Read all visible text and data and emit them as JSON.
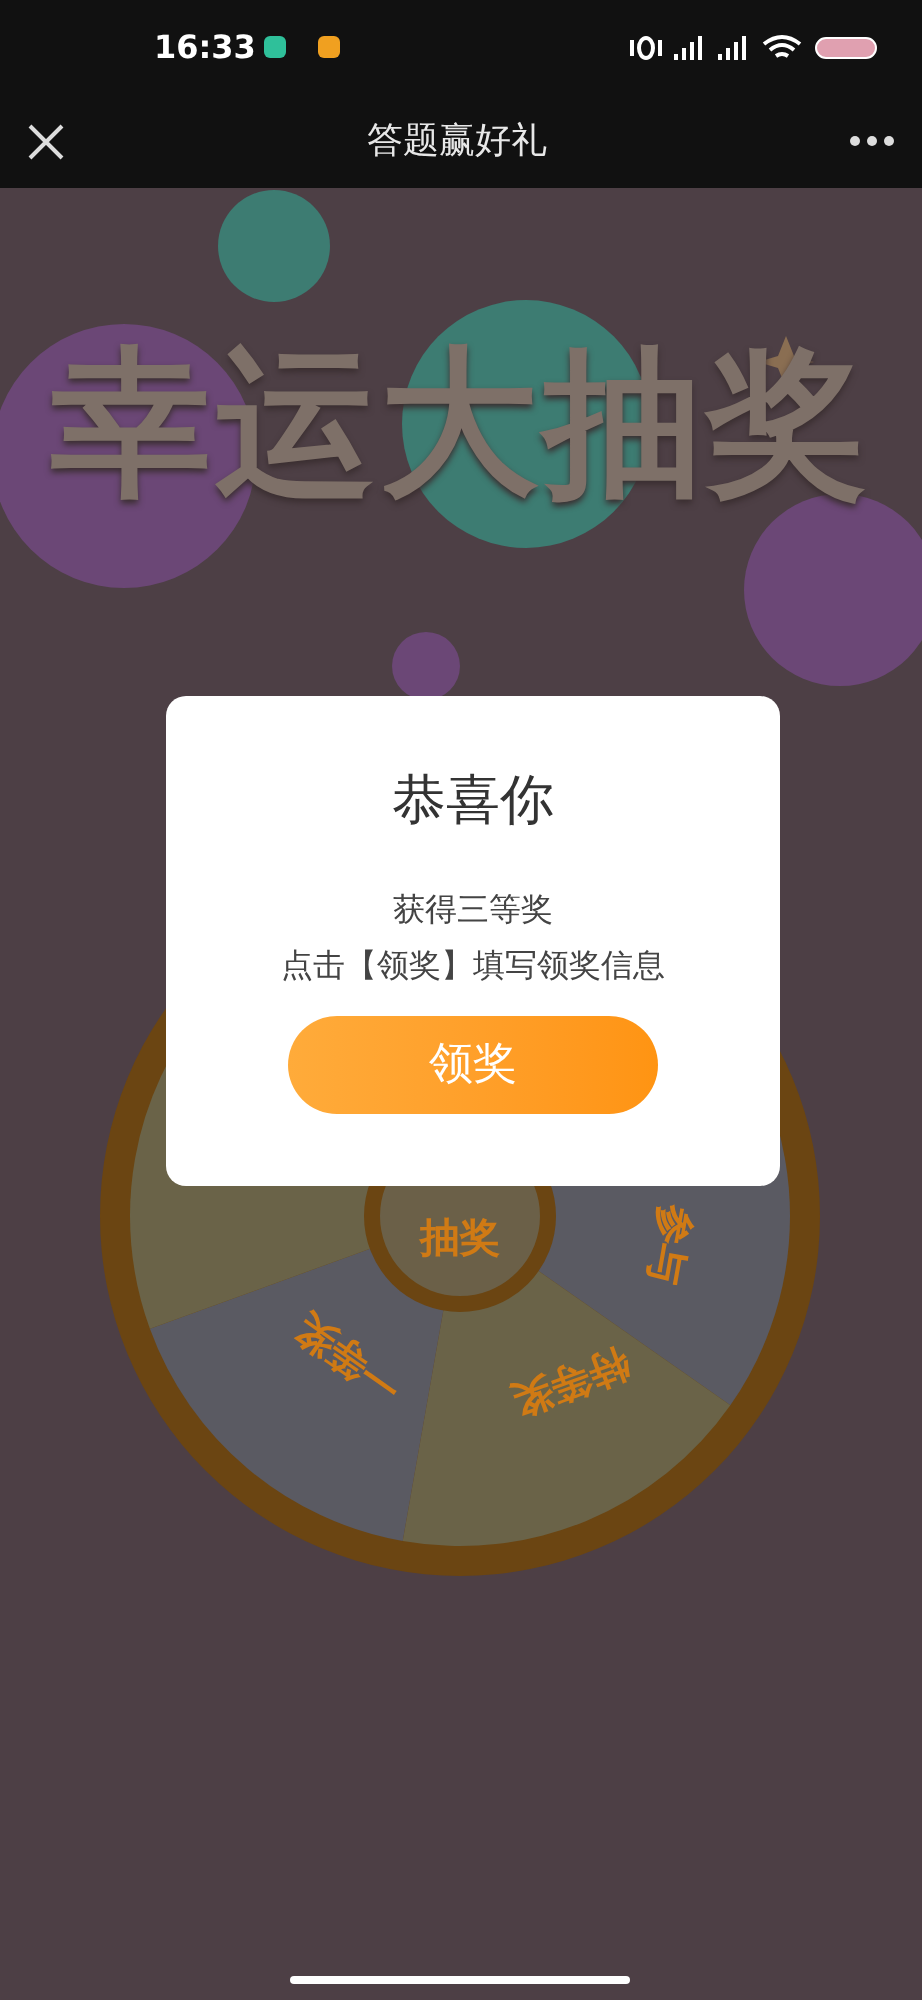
{
  "status_bar": {
    "time": "16:33"
  },
  "header": {
    "title": "答题赢好礼"
  },
  "banner": {
    "title": "幸运大抽奖"
  },
  "wheel": {
    "center_label": "抽奖",
    "segments": [
      {
        "label": "参与"
      },
      {
        "label": "特等奖"
      },
      {
        "label": "一等奖"
      }
    ]
  },
  "dialog": {
    "title": "恭喜你",
    "lines": [
      "获得三等奖",
      "点击【领奖】填写领奖信息"
    ],
    "button": "领奖"
  }
}
